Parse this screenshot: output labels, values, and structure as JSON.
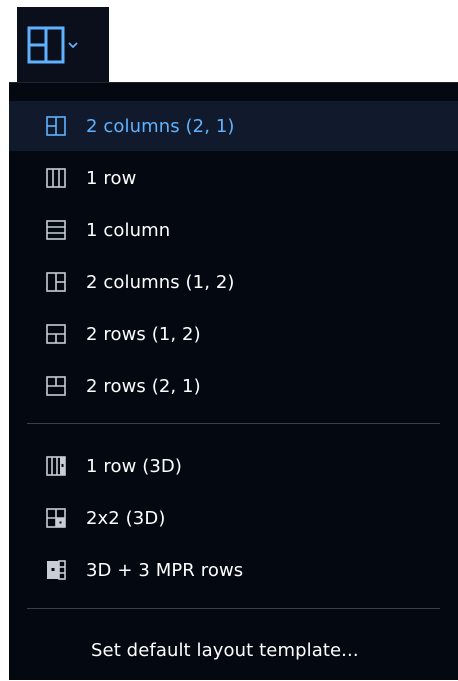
{
  "trigger": {
    "icon": "layout-two-columns-icon",
    "dropdown_icon": "chevron-down-icon"
  },
  "menu": {
    "items": [
      {
        "label": "2 columns (2, 1)",
        "icon": "layout-2-columns-2-1-icon",
        "selected": true
      },
      {
        "label": "1 row",
        "icon": "layout-1-row-icon",
        "selected": false
      },
      {
        "label": "1 column",
        "icon": "layout-1-column-icon",
        "selected": false
      },
      {
        "label": "2 columns (1, 2)",
        "icon": "layout-2-columns-1-2-icon",
        "selected": false
      },
      {
        "label": "2 rows (1, 2)",
        "icon": "layout-2-rows-1-2-icon",
        "selected": false
      },
      {
        "label": "2 rows (2, 1)",
        "icon": "layout-2-rows-2-1-icon",
        "selected": false
      }
    ],
    "items_3d": [
      {
        "label": "1 row (3D)",
        "icon": "layout-1-row-3d-icon"
      },
      {
        "label": "2x2 (3D)",
        "icon": "layout-2x2-3d-icon"
      },
      {
        "label": "3D + 3 MPR rows",
        "icon": "layout-3d-mpr-rows-icon"
      }
    ],
    "footer_label": "Set default layout template..."
  },
  "colors": {
    "menu_background": "#030811",
    "selected_background": "#111a2c",
    "selected_text": "#5fb2ff",
    "text": "#ffffff",
    "icon": "#c8cdd6",
    "trigger_icon": "#5fb2ff"
  }
}
